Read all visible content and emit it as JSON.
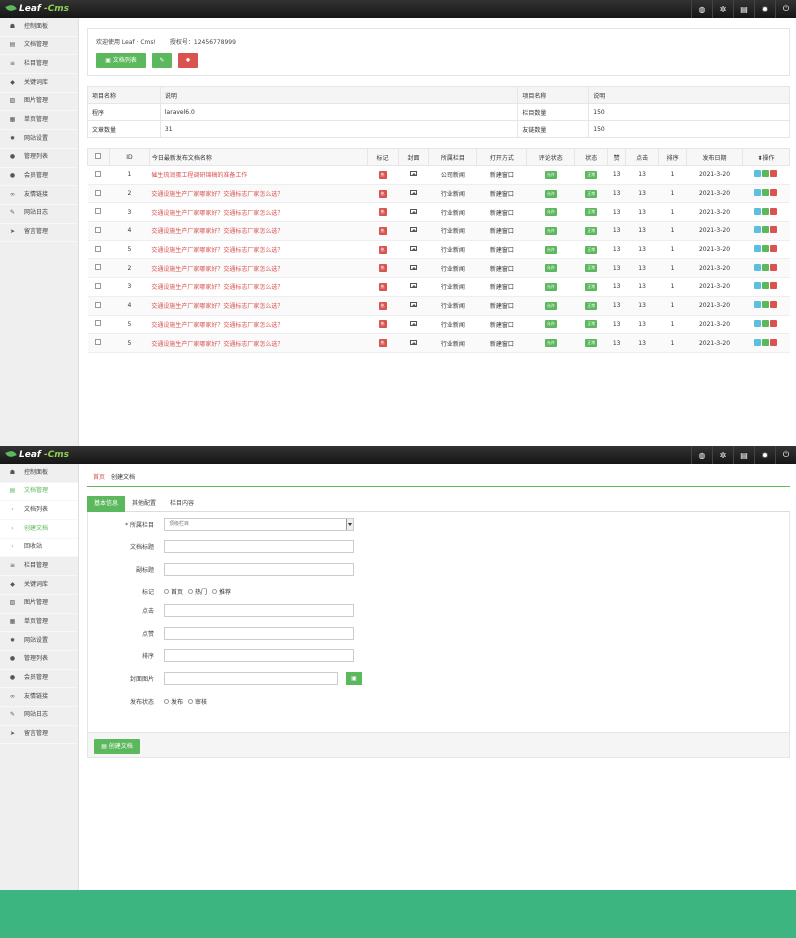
{
  "app": {
    "logo_main": "Leaf",
    "logo_accent": "-Cms"
  },
  "topbar_icons": [
    "globe-icon",
    "paw-icon",
    "trash-icon",
    "gear-icon",
    "power-icon"
  ],
  "sidebar1": [
    {
      "label": "控制面板",
      "icon": "dashboard-icon"
    },
    {
      "label": "文档管理",
      "icon": "file-icon"
    },
    {
      "label": "栏目管理",
      "icon": "list-icon"
    },
    {
      "label": "关键词库",
      "icon": "tag-icon"
    },
    {
      "label": "图片管理",
      "icon": "image-icon"
    },
    {
      "label": "单页管理",
      "icon": "page-icon"
    },
    {
      "label": "网站设置",
      "icon": "gear-icon"
    },
    {
      "label": "管理列表",
      "icon": "user-icon"
    },
    {
      "label": "会员管理",
      "icon": "users-icon"
    },
    {
      "label": "友情链接",
      "icon": "link-icon"
    },
    {
      "label": "网站日志",
      "icon": "edit-icon"
    },
    {
      "label": "留言管理",
      "icon": "send-icon"
    }
  ],
  "welcome": {
    "greeting": "欢迎使用 Leaf · Cms!",
    "license": "授权号：12456778999",
    "btn_list": "文档列表"
  },
  "info_table": {
    "headers": [
      "项目名称",
      "说明",
      "项目名称",
      "说明"
    ],
    "rows": [
      [
        "程序",
        "laravel6.0",
        "栏目数量",
        "150"
      ],
      [
        "文章数量",
        "31",
        "友链数量",
        "150"
      ]
    ]
  },
  "doc_table": {
    "headers": [
      "ID",
      "今日最新发布文档名称",
      "标记",
      "封面",
      "所属栏目",
      "打开方式",
      "评论状态",
      "状态",
      "赞",
      "点击",
      "排序",
      "发布日期",
      "操作"
    ],
    "rows": [
      {
        "id": "1",
        "title": "催生琉润蛋工程调研锦稿的准备工作",
        "mark": "热",
        "column": "公司新闻",
        "open": "新建窗口",
        "comment": "允许",
        "status": "正常",
        "likes": "13",
        "clicks": "13",
        "order": "1",
        "date": "2021-3-20"
      },
      {
        "id": "2",
        "title": "交通设施生产厂家哪家好？交通标志厂家怎么选？",
        "mark": "热",
        "column": "行业新闻",
        "open": "新建窗口",
        "comment": "允许",
        "status": "正常",
        "likes": "13",
        "clicks": "13",
        "order": "1",
        "date": "2021-3-20"
      },
      {
        "id": "3",
        "title": "交通设施生产厂家哪家好？交通标志厂家怎么选？",
        "mark": "热",
        "column": "行业新闻",
        "open": "新建窗口",
        "comment": "允许",
        "status": "正常",
        "likes": "13",
        "clicks": "13",
        "order": "1",
        "date": "2021-3-20"
      },
      {
        "id": "4",
        "title": "交通设施生产厂家哪家好？交通标志厂家怎么选？",
        "mark": "热",
        "column": "行业新闻",
        "open": "新建窗口",
        "comment": "允许",
        "status": "正常",
        "likes": "13",
        "clicks": "13",
        "order": "1",
        "date": "2021-3-20"
      },
      {
        "id": "5",
        "title": "交通设施生产厂家哪家好？交通标志厂家怎么选？",
        "mark": "热",
        "column": "行业新闻",
        "open": "新建窗口",
        "comment": "允许",
        "status": "正常",
        "likes": "13",
        "clicks": "13",
        "order": "1",
        "date": "2021-3-20"
      },
      {
        "id": "2",
        "title": "交通设施生产厂家哪家好？交通标志厂家怎么选？",
        "mark": "热",
        "column": "行业新闻",
        "open": "新建窗口",
        "comment": "允许",
        "status": "正常",
        "likes": "13",
        "clicks": "13",
        "order": "1",
        "date": "2021-3-20"
      },
      {
        "id": "3",
        "title": "交通设施生产厂家哪家好？交通标志厂家怎么选？",
        "mark": "热",
        "column": "行业新闻",
        "open": "新建窗口",
        "comment": "允许",
        "status": "正常",
        "likes": "13",
        "clicks": "13",
        "order": "1",
        "date": "2021-3-20"
      },
      {
        "id": "4",
        "title": "交通设施生产厂家哪家好？交通标志厂家怎么选？",
        "mark": "热",
        "column": "行业新闻",
        "open": "新建窗口",
        "comment": "允许",
        "status": "正常",
        "likes": "13",
        "clicks": "13",
        "order": "1",
        "date": "2021-3-20"
      },
      {
        "id": "5",
        "title": "交通设施生产厂家哪家好？交通标志厂家怎么选？",
        "mark": "热",
        "column": "行业新闻",
        "open": "新建窗口",
        "comment": "允许",
        "status": "正常",
        "likes": "13",
        "clicks": "13",
        "order": "1",
        "date": "2021-3-20"
      },
      {
        "id": "5",
        "title": "交通设施生产厂家哪家好？交通标志厂家怎么选？",
        "mark": "热",
        "column": "行业新闻",
        "open": "新建窗口",
        "comment": "允许",
        "status": "正常",
        "likes": "13",
        "clicks": "13",
        "order": "1",
        "date": "2021-3-20"
      }
    ]
  },
  "sidebar2": [
    {
      "label": "控制面板",
      "icon": "dashboard-icon",
      "kind": "top"
    },
    {
      "label": "文档管理",
      "icon": "file-icon",
      "kind": "active"
    },
    {
      "label": "文档列表",
      "icon": "chevron-right-icon",
      "kind": "sub"
    },
    {
      "label": "创建文档",
      "icon": "chevron-right-icon",
      "kind": "sub-cur"
    },
    {
      "label": "回收站",
      "icon": "chevron-right-icon",
      "kind": "sub"
    },
    {
      "label": "栏目管理",
      "icon": "list-icon",
      "kind": "top"
    },
    {
      "label": "关键词库",
      "icon": "tag-icon",
      "kind": "top"
    },
    {
      "label": "图片管理",
      "icon": "image-icon",
      "kind": "top"
    },
    {
      "label": "单页管理",
      "icon": "page-icon",
      "kind": "top"
    },
    {
      "label": "网站设置",
      "icon": "gear-icon",
      "kind": "top"
    },
    {
      "label": "管理列表",
      "icon": "user-icon",
      "kind": "top"
    },
    {
      "label": "会员管理",
      "icon": "users-icon",
      "kind": "top"
    },
    {
      "label": "友情链接",
      "icon": "link-icon",
      "kind": "top"
    },
    {
      "label": "网站日志",
      "icon": "edit-icon",
      "kind": "top"
    },
    {
      "label": "留言管理",
      "icon": "send-icon",
      "kind": "top"
    }
  ],
  "create": {
    "breadcrumb_home": "首页",
    "breadcrumb_current": "创建文档",
    "tabs": [
      "基本信息",
      "其他配置",
      "栏目内容"
    ],
    "fields": {
      "column_label": "* 所属栏目",
      "column_value": "顶级栏目",
      "title_label": "文档标题",
      "subtitle_label": "副标题",
      "mark_label": "标记",
      "mark_options": [
        "首页",
        "热门",
        "推荐"
      ],
      "clicks_label": "点击",
      "likes_label": "点赞",
      "order_label": "排序",
      "cover_label": "封面图片",
      "publish_label": "发布状态",
      "publish_options": [
        "发布",
        "审核"
      ]
    },
    "submit_label": "创建文档"
  },
  "colors": {
    "accent": "#5cb85c",
    "danger": "#d9534f",
    "info": "#5bc0de",
    "footer": "#3cb581"
  }
}
